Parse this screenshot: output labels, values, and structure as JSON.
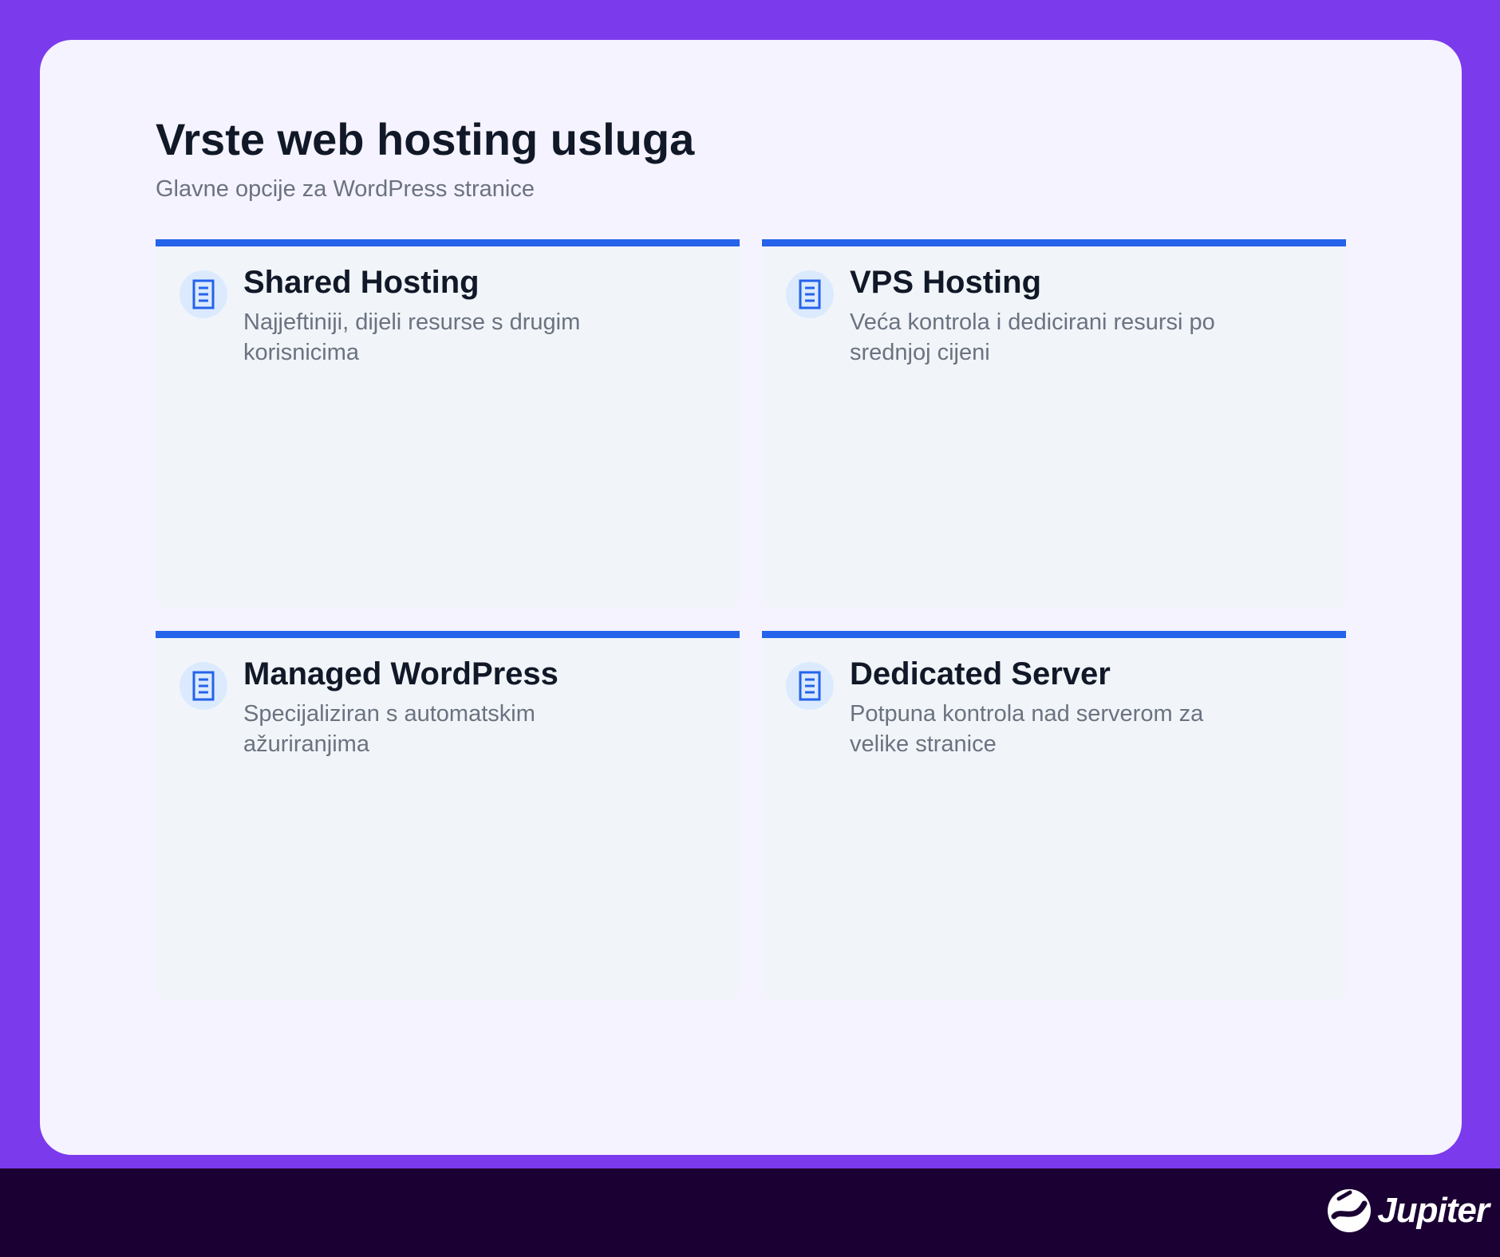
{
  "header": {
    "title": "Vrste web hosting usluga",
    "subtitle": "Glavne opcije za WordPress stranice"
  },
  "cards": [
    {
      "title": "Shared Hosting",
      "description": "Najjeftiniji, dijeli resurse s drugim korisnicima",
      "icon": "server-document-icon"
    },
    {
      "title": "VPS Hosting",
      "description": "Veća kontrola i dedicirani resursi po srednjoj cijeni",
      "icon": "server-document-icon"
    },
    {
      "title": "Managed WordPress",
      "description": "Specijaliziran s automatskim ažuriranjima",
      "icon": "server-document-icon"
    },
    {
      "title": "Dedicated Server",
      "description": "Potpuna kontrola nad serverom za velike stranice",
      "icon": "server-document-icon"
    }
  ],
  "footer": {
    "logo_text": "Jupiter"
  },
  "colors": {
    "background": "#7c3aed",
    "panel": "#f5f3ff",
    "card": "#f1f5f9",
    "accent": "#2563eb",
    "footer": "#1b0033"
  }
}
